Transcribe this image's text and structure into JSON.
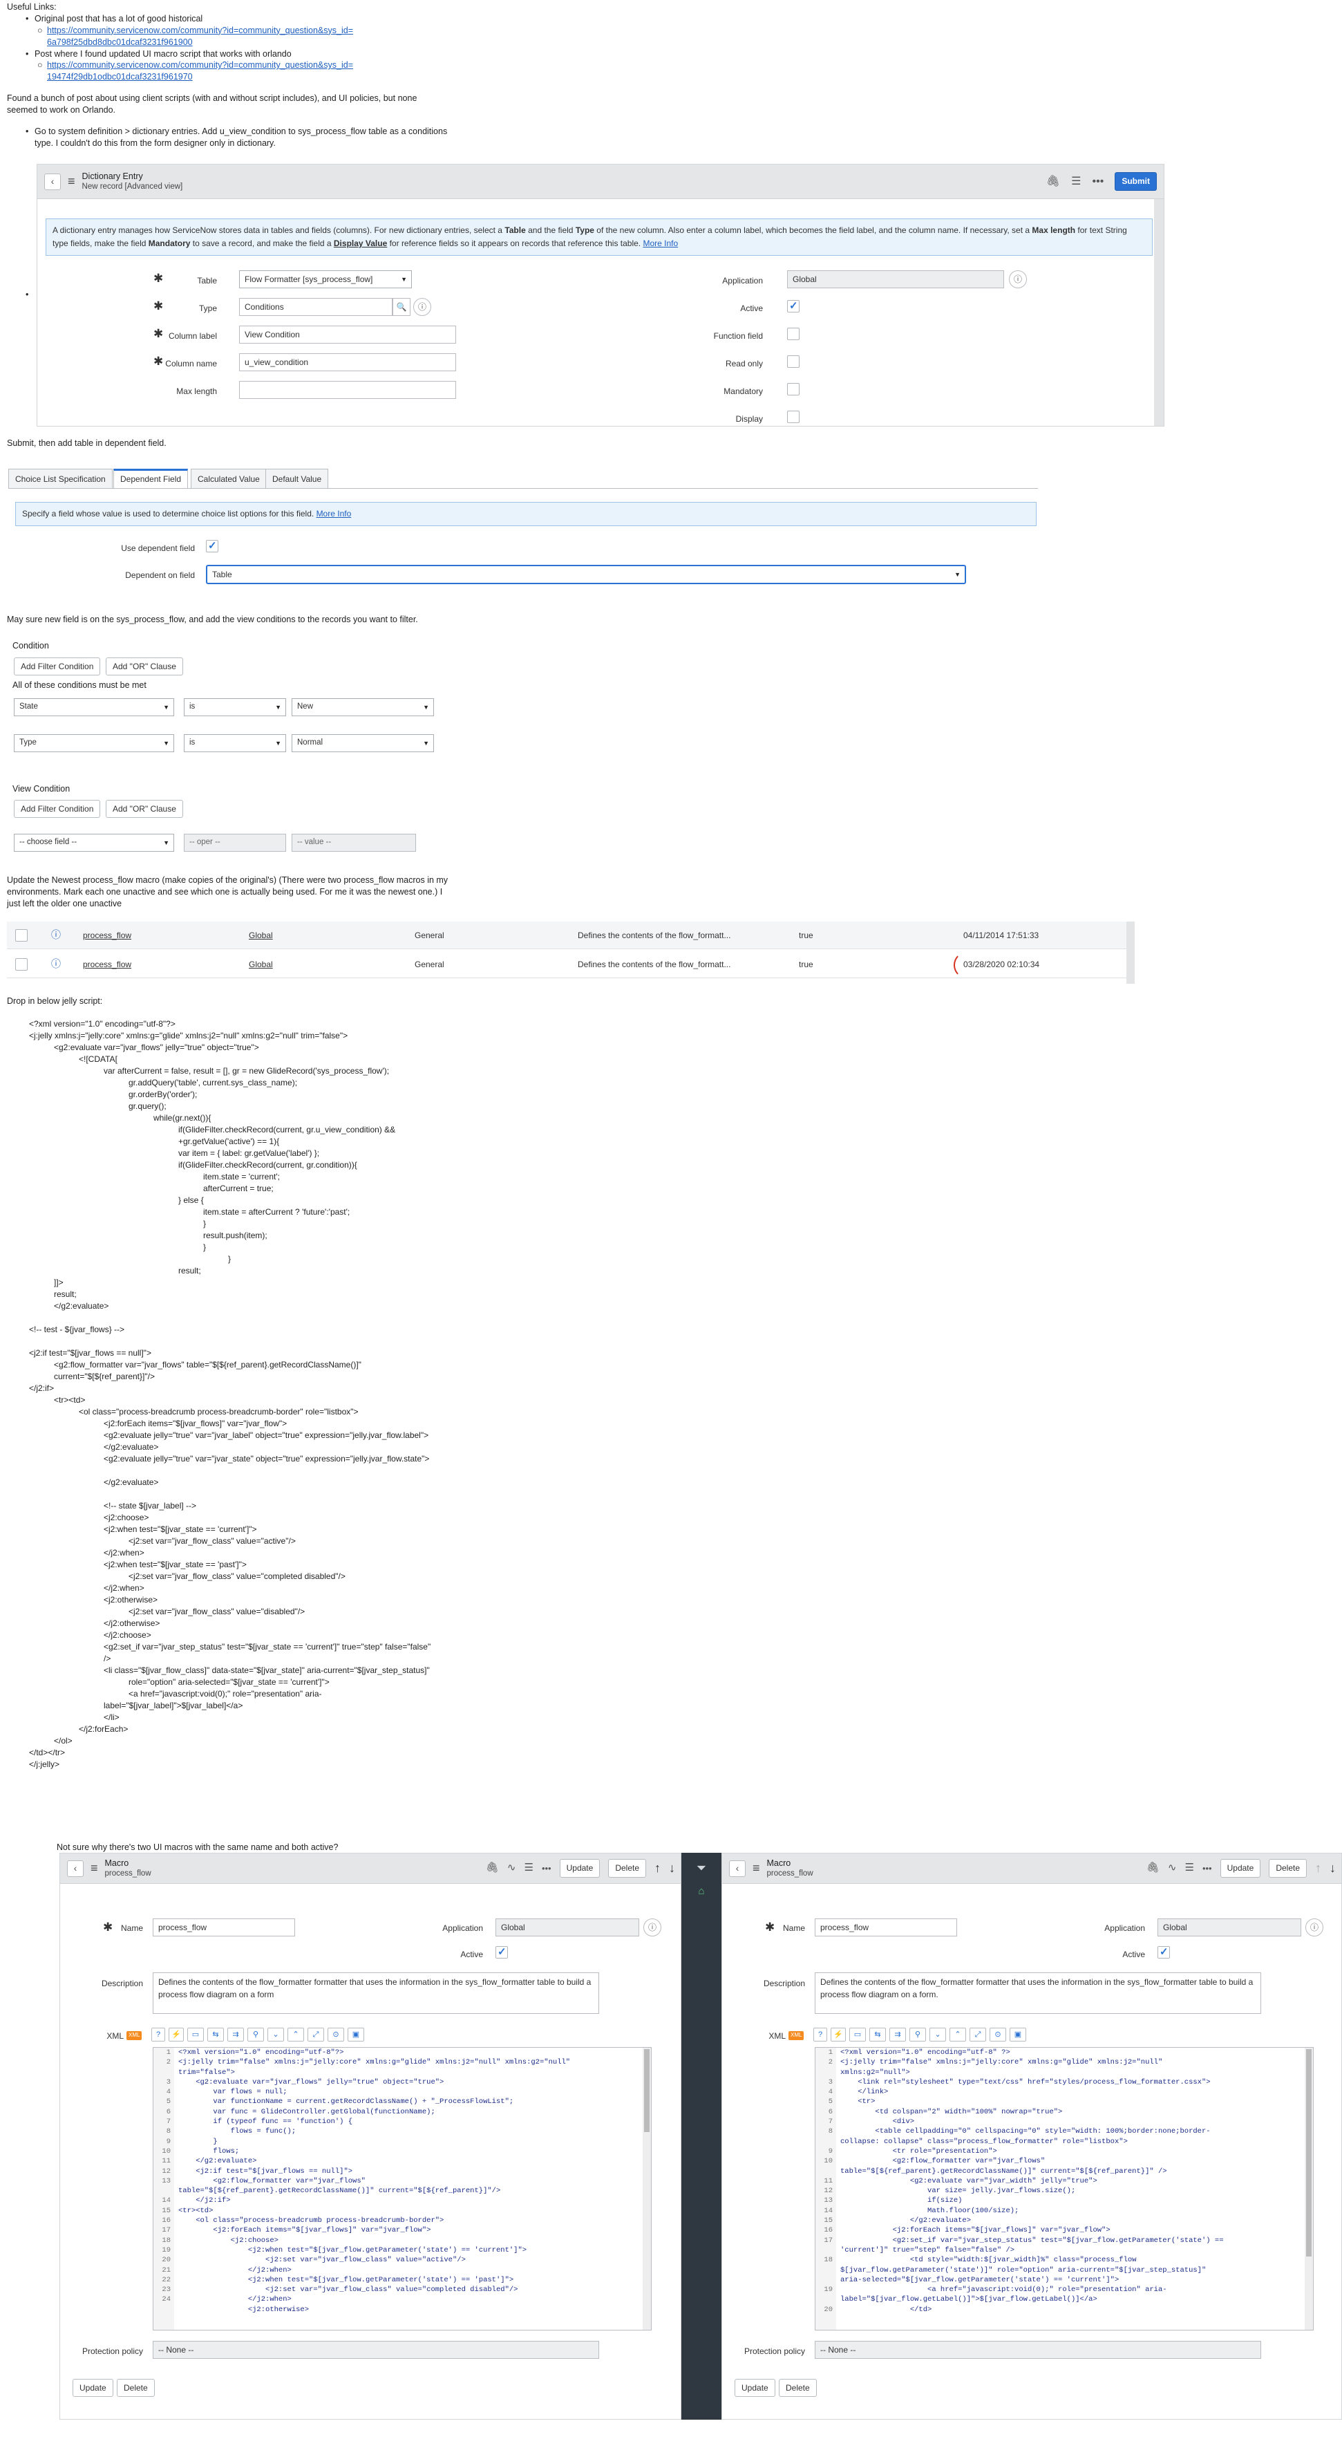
{
  "intro": {
    "useful_links": "Useful Links:",
    "link1_desc": "Original post that has a lot of good historical",
    "link1_url_a": "https://community.servicenow.com/community?id=community_question&sys_id=",
    "link1_url_b": "6a798f25dbd8dbc01dcaf3231f961900",
    "link2_desc": "Post where I found updated UI macro script that works with orlando",
    "link2_url_a": "https://community.servicenow.com/community?id=community_question&sys_id=",
    "link2_url_b": "19474f29db1odbc01dcaf3231f961970",
    "para1_a": "Found a bunch of post about using client scripts (with and without script includes), and UI policies, but none",
    "para1_b": "seemed to work on Orlando.",
    "step1_a": "Go to system definition > dictionary entries. Add u_view_condition to sys_process_flow table as a conditions",
    "step1_b": "type. I couldn't do this from the form designer only in dictionary."
  },
  "dict_form": {
    "title": "Dictionary Entry",
    "subtitle": "New record [Advanced view]",
    "submit": "Submit",
    "info_a": "A dictionary entry manages how ServiceNow stores data in tables and fields (columns). For new dictionary entries, select a ",
    "info_table": "Table",
    "info_b": " and the field ",
    "info_type": "Type",
    "info_c": " of the new column. Also enter a column label, which becomes the field label, and the column name. If necessary, set a ",
    "info_maxlen": "Max length",
    "info_d": " for text String",
    "info_e": "type fields, make the field ",
    "info_mand": "Mandatory",
    "info_f": " to save a record, and make the field a ",
    "info_disp": "Display Value",
    "info_g": " for reference fields so it appears on records that reference this table. ",
    "info_more": "More Info",
    "table_label": "Table",
    "table_value": "Flow Formatter [sys_process_flow]",
    "type_label": "Type",
    "type_value": "Conditions",
    "col_label_label": "Column label",
    "col_label_value": "View Condition",
    "col_name_label": "Column name",
    "col_name_value": "u_view_condition",
    "max_length_label": "Max length",
    "application_label": "Application",
    "application_value": "Global",
    "active_label": "Active",
    "function_label": "Function field",
    "readonly_label": "Read only",
    "mandatory_label": "Mandatory",
    "display_label": "Display"
  },
  "step2": "Submit, then add table in dependent field.",
  "dep_form": {
    "tabs": [
      "Choice List Specification",
      "Dependent Field",
      "Calculated Value",
      "Default Value"
    ],
    "info": "Specify a field whose value is used to determine choice list options for this field. ",
    "more": "More Info",
    "use_dep_label": "Use dependent field",
    "dep_on_label": "Dependent on field",
    "dep_on_value": "Table"
  },
  "step3": "May sure new field is on the  sys_process_flow, and add the view conditions to the records you want to filter.",
  "cond": {
    "title": "Condition",
    "add_filter": "Add Filter Condition",
    "add_or": "Add \"OR\" Clause",
    "all_met": "All of these conditions must be met",
    "row1": [
      "State",
      "is",
      "New"
    ],
    "row2": [
      "Type",
      "is",
      "Normal"
    ],
    "view_title": "View Condition",
    "view_row": [
      "-- choose field --",
      "-- oper --",
      "-- value --"
    ]
  },
  "step4_a": "Update the Newest process_flow macro (make copies of the original's) (There were two process_flow macros in my",
  "step4_b": "environments. Mark each one unactive and see which one is actually being used. For me it was the newest one.) I",
  "step4_c": "just left the older one unactive",
  "list_rows": [
    {
      "name": "process_flow",
      "app": "Global",
      "cat": "General",
      "desc": "Defines the contents of the flow_formatt...",
      "active": "true",
      "date": "04/11/2014 17:51:33"
    },
    {
      "name": "process_flow",
      "app": "Global",
      "cat": "General",
      "desc": "Defines the contents of the flow_formatt...",
      "active": "true",
      "date": "03/28/2020 02:10:34"
    }
  ],
  "step5": "Drop in below jelly script:",
  "jelly": [
    "<?xml version=\"1.0\" encoding=\"utf-8\"?>",
    "<j:jelly xmlns:j=\"jelly:core\" xmlns:g=\"glide\" xmlns:j2=\"null\" xmlns:g2=\"null\" trim=\"false\">",
    "<g2:evaluate var=\"jvar_flows\" jelly=\"true\" object=\"true\">",
    "<![CDATA[",
    "var afterCurrent = false, result = [], gr = new GlideRecord('sys_process_flow');",
    "gr.addQuery('table', current.sys_class_name);",
    "gr.orderBy('order');",
    "gr.query();",
    "while(gr.next()){",
    "if(GlideFilter.checkRecord(current, gr.u_view_condition) &&",
    "+gr.getValue('active') == 1){",
    "var item = { label: gr.getValue('label') };",
    "if(GlideFilter.checkRecord(current, gr.condition)){",
    "item.state = 'current';",
    "afterCurrent = true;",
    "} else {",
    "item.state = afterCurrent ? 'future':'past';",
    "}",
    "result.push(item);",
    "}",
    "}",
    "result;",
    "]]>",
    "result;",
    "</g2:evaluate>",
    "<!-- test - ${jvar_flows} -->",
    "<j2:if test=\"$[jvar_flows == null]\">",
    "<g2:flow_formatter var=\"jvar_flows\" table=\"$[${ref_parent}.getRecordClassName()]\"",
    "current=\"$[${ref_parent}]\"/>",
    "</j2:if>",
    "<tr><td>",
    "<ol class=\"process-breadcrumb process-breadcrumb-border\" role=\"listbox\">",
    "<j2:forEach items=\"$[jvar_flows]\" var=\"jvar_flow\">",
    "<g2:evaluate jelly=\"true\" var=\"jvar_label\" object=\"true\" expression=\"jelly.jvar_flow.label\">",
    "</g2:evaluate>",
    "<g2:evaluate jelly=\"true\" var=\"jvar_state\" object=\"true\" expression=\"jelly.jvar_flow.state\">",
    "</g2:evaluate>",
    "<!-- state $[jvar_label] -->",
    "<j2:choose>",
    "<j2:when test=\"$[jvar_state == 'current']\">",
    "<j2:set var=\"jvar_flow_class\" value=\"active\"/>",
    "</j2:when>",
    "<j2:when test=\"$[jvar_state == 'past']\">",
    "<j2:set var=\"jvar_flow_class\" value=\"completed disabled\"/>",
    "</j2:when>",
    "<j2:otherwise>",
    "<j2:set var=\"jvar_flow_class\" value=\"disabled\"/>",
    "</j2:otherwise>",
    "</j2:choose>",
    "<g2:set_if var=\"jvar_step_status\" test=\"$[jvar_state == 'current']\" true=\"step\" false=\"false\"",
    "/>",
    "<li class=\"$[jvar_flow_class]\" data-state=\"$[jvar_state]\" aria-current=\"$[jvar_step_status]\"",
    "role=\"option\" aria-selected=\"$[jvar_state == 'current']\">",
    "<a href=\"javascript:void(0);\" role=\"presentation\" aria-",
    "label=\"$[jvar_label]\">$[jvar_label]</a>",
    "</li>",
    "</j2:forEach>",
    "</ol>",
    "</td></tr>",
    "</j:jelly>"
  ],
  "step6": "Not sure why there's two UI macros with the same name and both active?",
  "macro": {
    "title": "Macro",
    "subtitle": "process_flow",
    "update": "Update",
    "delete": "Delete",
    "name_label": "Name",
    "name_value": "process_flow",
    "app_label": "Application",
    "app_value": "Global",
    "active_label": "Active",
    "desc_label": "Description",
    "desc_left": "Defines the contents of the flow_formatter formatter that uses the information in the sys_flow_formatter table to build a process flow diagram on a form",
    "desc_right": "Defines the contents of the flow_formatter formatter that uses the information in the sys_flow_formatter table to build a process flow diagram on a form.",
    "xml_label": "XML",
    "xml_badge": "XML",
    "protection_label": "Protection policy",
    "protection_value": "-- None --"
  },
  "xml_left": [
    "<?xml version=\"1.0\" encoding=\"utf-8\"?>",
    "<j:jelly trim=\"false\" xmlns:j=\"jelly:core\" xmlns:g=\"glide\" xmlns:j2=\"null\" xmlns:g2=\"null\"",
    "trim=\"false\">",
    "    <g2:evaluate var=\"jvar_flows\" jelly=\"true\" object=\"true\">",
    "        var flows = null;",
    "        var functionName = current.getRecordClassName() + \"_ProcessFlowList\";",
    "        var func = GlideController.getGlobal(functionName);",
    "        if (typeof func == 'function') {",
    "            flows = func();",
    "        }",
    "        flows;",
    "    </g2:evaluate>",
    "    <j2:if test=\"$[jvar_flows == null]\">",
    "        <g2:flow_formatter var=\"jvar_flows\"",
    "table=\"$[${ref_parent}.getRecordClassName()]\" current=\"$[${ref_parent}]\"/>",
    "    </j2:if>",
    "<tr><td>",
    "    <ol class=\"process-breadcrumb process-breadcrumb-border\">",
    "        <j2:forEach items=\"$[jvar_flows]\" var=\"jvar_flow\">",
    "            <j2:choose>",
    "                <j2:when test=\"$[jvar_flow.getParameter('state') == 'current']\">",
    "                    <j2:set var=\"jvar_flow_class\" value=\"active\"/>",
    "                </j2:when>",
    "                <j2:when test=\"$[jvar_flow.getParameter('state') == 'past']\">",
    "                    <j2:set var=\"jvar_flow_class\" value=\"completed disabled\"/>",
    "                </j2:when>",
    "                <j2:otherwise>"
  ],
  "xml_left_ln": [
    "1",
    "2",
    "",
    "3",
    "4",
    "5",
    "6",
    "7",
    "8",
    "9",
    "10",
    "11",
    "12",
    "13",
    "",
    "14",
    "15",
    "16",
    "17",
    "18",
    "19",
    "20",
    "21",
    "22",
    "23",
    "24"
  ],
  "xml_right": [
    "<?xml version=\"1.0\" encoding=\"utf-8\" ?>",
    "<j:jelly trim=\"false\" xmlns:j=\"jelly:core\" xmlns:g=\"glide\" xmlns:j2=\"null\"",
    "xmlns:g2=\"null\">",
    "    <link rel=\"stylesheet\" type=\"text/css\" href=\"styles/process_flow_formatter.cssx\">",
    "    </link>",
    "    <tr>",
    "        <td colspan=\"2\" width=\"100%\" nowrap=\"true\">",
    "            <div>",
    "        <table cellpadding=\"0\" cellspacing=\"0\" style=\"width: 100%;border:none;border-",
    "collapse: collapse\" class=\"process_flow_formatter\" role=\"listbox\">",
    "            <tr role=\"presentation\">",
    "            <g2:flow_formatter var=\"jvar_flows\"",
    "table=\"$[${ref_parent}.getRecordClassName()]\" current=\"$[${ref_parent}]\" />",
    "                <g2:evaluate var=\"jvar_width\" jelly=\"true\">",
    "                    var size= jelly.jvar_flows.size();",
    "                    if(size)",
    "                    Math.floor(100/size);",
    "                </g2:evaluate>",
    "            <j2:forEach items=\"$[jvar_flows]\" var=\"jvar_flow\">",
    "            <g2:set_if var=\"jvar_step_status\" test=\"$[jvar_flow.getParameter('state') ==",
    "'current']\" true=\"step\" false=\"false\" />",
    "                <td style=\"width:$[jvar_width]%\" class=\"process_flow",
    "$[jvar_flow.getParameter('state')]\" role=\"option\" aria-current=\"$[jvar_step_status]\"",
    "aria-selected=\"$[jvar_flow.getParameter('state') == 'current']\">",
    "                    <a href=\"javascript:void(0);\" role=\"presentation\" aria-",
    "label=\"$[jvar_flow.getLabel()]\">$[jvar_flow.getLabel()]</a>",
    "                </td>"
  ],
  "xml_right_ln": [
    "1",
    "2",
    "",
    "3",
    "4",
    "5",
    "6",
    "7",
    "8",
    "",
    "9",
    "10",
    "",
    "11",
    "12",
    "13",
    "14",
    "15",
    "16",
    "17",
    "",
    "18",
    "",
    "",
    "19",
    "",
    "20"
  ]
}
